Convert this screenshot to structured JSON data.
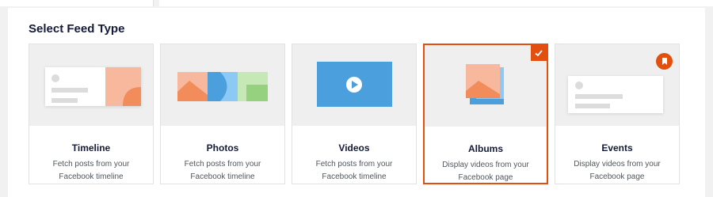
{
  "header": {
    "title": "Select Feed Type"
  },
  "feed_types": [
    {
      "title": "Timeline",
      "description": "Fetch posts from your Facebook timeline",
      "selected": false,
      "icon": "timeline-illustration-icon"
    },
    {
      "title": "Photos",
      "description": "Fetch posts from your Facebook timeline",
      "selected": false,
      "icon": "photos-illustration-icon"
    },
    {
      "title": "Videos",
      "description": "Fetch posts from your Facebook timeline",
      "selected": false,
      "icon": "video-play-illustration-icon"
    },
    {
      "title": "Albums",
      "description": "Display videos from your Facebook page",
      "selected": true,
      "icon": "albums-illustration-icon"
    },
    {
      "title": "Events",
      "description": "Display videos from your Facebook page",
      "selected": false,
      "icon": "events-illustration-icon"
    }
  ],
  "colors": {
    "accent": "#e34f0e",
    "salmon": "#f8b89d",
    "salmon_dark": "#f28c5a",
    "blue": "#4a9fdc",
    "light_blue": "#8ccaf5",
    "green": "#96d180",
    "grey_bar": "#dcdcdc"
  }
}
